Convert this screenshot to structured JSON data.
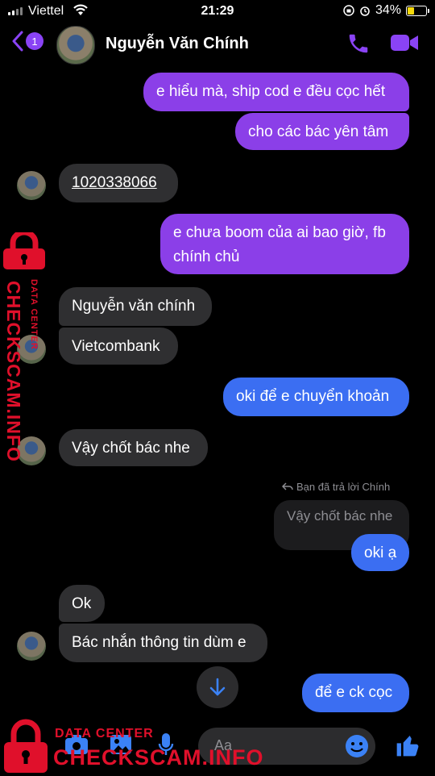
{
  "status_bar": {
    "carrier": "Viettel",
    "time": "21:29",
    "battery": "34%"
  },
  "header": {
    "back_badge": "1",
    "contact_name": "Nguyễn Văn Chính"
  },
  "messages": [
    {
      "dir": "out",
      "text": "e hiểu mà, ship cod e đều cọc hết"
    },
    {
      "dir": "out",
      "text": "cho các bác yên tâm"
    },
    {
      "dir": "in",
      "text": "1020338066"
    },
    {
      "dir": "out",
      "text": "e chưa boom của ai bao giờ, fb"
    },
    {
      "dir": "out",
      "text": "chính chủ"
    },
    {
      "dir": "in",
      "text": "Nguyễn văn chính"
    },
    {
      "dir": "in",
      "text": "Vietcombank"
    },
    {
      "dir": "out",
      "text": "oki để e chuyển khoản"
    },
    {
      "dir": "in",
      "text": "Vậy chốt bác nhe"
    },
    {
      "dir": "out",
      "text": "oki ạ"
    },
    {
      "dir": "in",
      "text": "Ok"
    },
    {
      "dir": "in",
      "text": "Bác nhắn thông tin dùm e"
    },
    {
      "dir": "out",
      "text": "để e ck cọc"
    }
  ],
  "reply": {
    "label": "Bạn đã trả lời Chính",
    "quoted": "Vậy chốt bác nhe"
  },
  "composer": {
    "placeholder": "Aa"
  },
  "watermark": {
    "line1": "DATA CENTER",
    "line2": "CHECKSCAM.INFO"
  },
  "colors": {
    "accent": "#8b3fe8",
    "outgoing_blue": "#3b6ef2",
    "incoming": "#2f2f31",
    "watermark": "#e0102b"
  },
  "icons": [
    "back-chevron-icon",
    "phone-icon",
    "video-camera-icon",
    "arrow-down-icon",
    "camera-icon",
    "image-icon",
    "microphone-icon",
    "emoji-icon",
    "thumbs-up-icon",
    "lock-icon",
    "reply-icon",
    "wifi-icon",
    "battery-icon"
  ]
}
